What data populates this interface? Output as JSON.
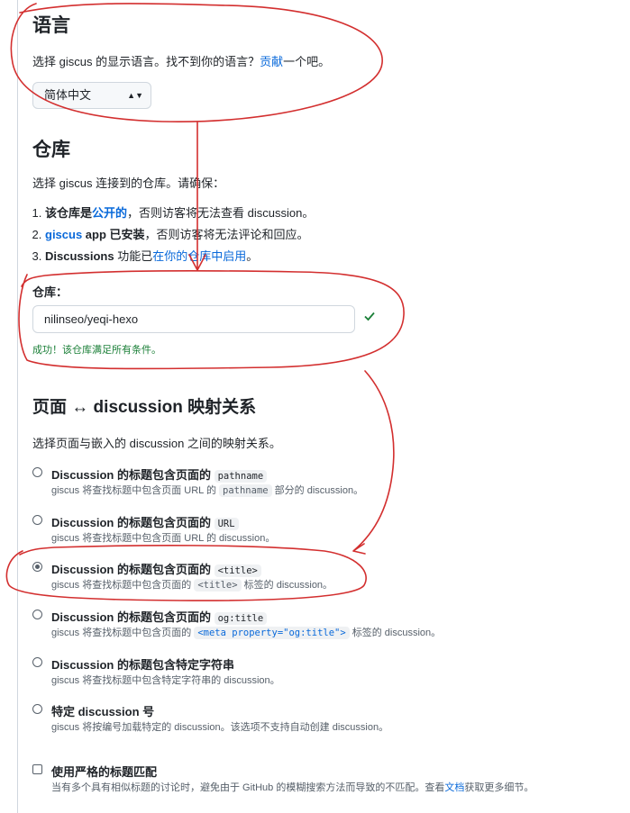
{
  "language": {
    "heading": "语言",
    "desc_before": "选择 giscus 的显示语言。找不到你的语言？",
    "desc_link": "贡献",
    "desc_after": "一个吧。",
    "selected": "简体中文"
  },
  "repository": {
    "heading": "仓库",
    "intro": "选择 giscus 连接到的仓库。请确保：",
    "items": [
      {
        "bold": "该仓库是",
        "link": "公开的",
        "rest": "，否则访客将无法查看 discussion。"
      },
      {
        "link": "giscus",
        "bold": " app 已安装",
        "rest": "，否则访客将无法评论和回应。"
      },
      {
        "bold": "Discussions",
        "text": " 功能已",
        "link": "在你的仓库中启用",
        "rest": "。"
      }
    ],
    "field_label": "仓库：",
    "field_value": "nilinseo/yeqi-hexo",
    "success": "成功！该仓库满足所有条件。"
  },
  "mapping": {
    "heading": "页面 ↔ discussion 映射关系",
    "intro": "选择页面与嵌入的 discussion 之间的映射关系。",
    "options": [
      {
        "title": "Discussion 的标题包含页面的",
        "code": "pathname",
        "desc_before": "giscus 将查找标题中包含页面 URL 的",
        "desc_code": "pathname",
        "desc_after": "部分的 discussion。",
        "checked": false
      },
      {
        "title": "Discussion 的标题包含页面的",
        "code": "URL",
        "desc_before": "giscus 将查找标题中包含页面 URL 的 discussion。",
        "checked": false
      },
      {
        "title": "Discussion 的标题包含页面的",
        "code": "<title>",
        "desc_before": "giscus 将查找标题中包含页面的",
        "desc_code": "<title>",
        "desc_after": "标签的 discussion。",
        "checked": true
      },
      {
        "title": "Discussion 的标题包含页面的",
        "code": "og:title",
        "desc_before": "giscus 将查找标题中包含页面的",
        "desc_code": "<meta property=\"og:title\">",
        "desc_after": "标签的 discussion。",
        "checked": false
      },
      {
        "title": "Discussion 的标题包含特定字符串",
        "desc_before": "giscus 将查找标题中包含特定字符串的 discussion。",
        "checked": false
      },
      {
        "title": "特定 discussion 号",
        "desc_before": "giscus 将按编号加载特定的 discussion。该选项不支持自动创建 discussion。",
        "checked": false
      }
    ],
    "strict": {
      "label": "使用严格的标题匹配",
      "desc_before": "当有多个具有相似标题的讨论时，避免由于 GitHub 的模糊搜索方法而导致的不匹配。查看",
      "desc_link": "文档",
      "desc_after": "获取更多细节。",
      "checked": false
    }
  },
  "colors": {
    "link": "#0969da",
    "success": "#1a7f37",
    "annotation": "#d32f2f"
  }
}
